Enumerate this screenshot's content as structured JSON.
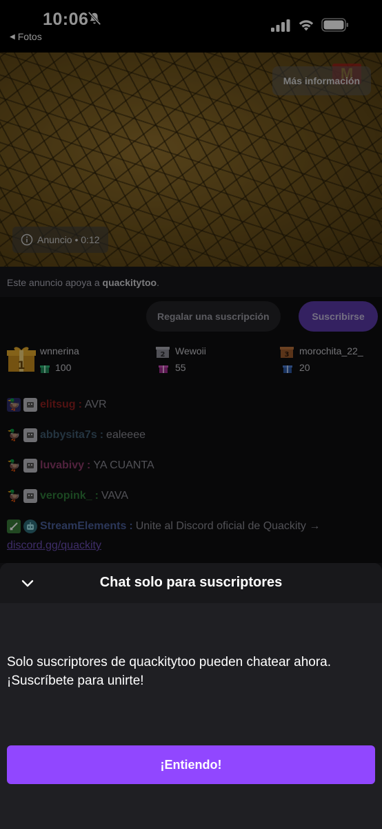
{
  "status_bar": {
    "time": "10:06",
    "back_label": "Fotos"
  },
  "ad": {
    "more_info": "Más información",
    "label": "Anuncio • 0:12",
    "support_prefix": "Este anuncio apoya a ",
    "support_channel": "quackitytoo",
    "support_suffix": "."
  },
  "actions": {
    "gift_label": "Regalar una suscripción",
    "subscribe_label": "Suscribirse"
  },
  "leaderboard": [
    {
      "rank": "1",
      "name": "wnnerina",
      "count": "100"
    },
    {
      "rank": "2",
      "name": "Wewoii",
      "count": "55"
    },
    {
      "rank": "3",
      "name": "morochita_22_",
      "count": "20"
    }
  ],
  "chat": [
    {
      "user": "elitsug",
      "text": "AVR",
      "color": "#8e1f1f"
    },
    {
      "user": "abbysita7s",
      "text": "ealeeee",
      "color": "#3f5a6e"
    },
    {
      "user": "luvabivy",
      "text": "YA CUANTA",
      "color": "#8c3b6a"
    },
    {
      "user": "veropink_",
      "text": "VAVA",
      "color": "#2f7a3a"
    },
    {
      "user": "StreamElements",
      "text": "Unite al Discord oficial de Quackity →",
      "link": "discord.gg/quackity",
      "color": "#4a5f9a"
    }
  ],
  "sheet": {
    "title": "Chat solo para suscriptores",
    "body": "Solo suscriptores de quackitytoo pueden chatear ahora. ¡Suscríbete para unirte!",
    "button": "¡Entiendo!"
  },
  "colors": {
    "accent": "#9147ff",
    "background": "#0e0e10",
    "sheet": "#1f1f23"
  }
}
